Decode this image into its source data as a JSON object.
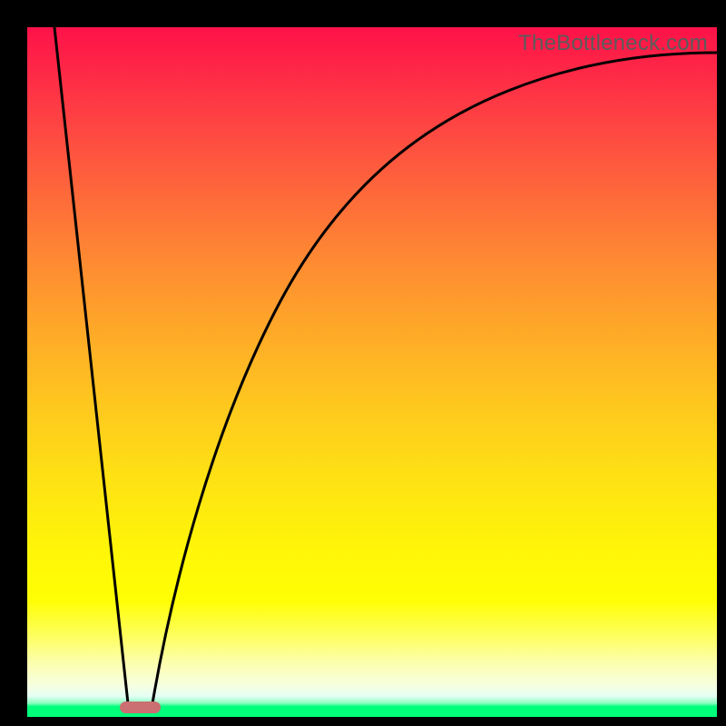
{
  "watermark": "TheBottleneck.com",
  "colors": {
    "frame": "#000000",
    "curve_stroke": "#000000",
    "marker_fill": "#cb6f72",
    "gradient_top": "#fe1248",
    "gradient_bottom": "#00ff7b"
  },
  "chart_data": {
    "type": "line",
    "title": "",
    "xlabel": "",
    "ylabel": "",
    "xlim": [
      0,
      100
    ],
    "ylim": [
      0,
      100
    ],
    "note": "No axis tick labels or numeric annotations are visible in the image; y-values below are read as percent of plot height from bottom, x as percent of plot width from left.",
    "series": [
      {
        "name": "left-descending-segment",
        "x": [
          4.0,
          8.0,
          12.0,
          14.6
        ],
        "y": [
          100.0,
          67.0,
          33.0,
          2.0
        ]
      },
      {
        "name": "right-ascending-curve",
        "x": [
          18.2,
          20.0,
          24.0,
          28.0,
          33.0,
          40.0,
          48.0,
          57.0,
          67.0,
          78.0,
          89.0,
          100.0
        ],
        "y": [
          2.0,
          11.0,
          30.0,
          45.0,
          58.0,
          70.0,
          79.0,
          85.5,
          90.0,
          93.0,
          95.0,
          96.2
        ]
      }
    ],
    "marker": {
      "shape": "rounded-bar",
      "x_center": 16.4,
      "y_center": 1.1,
      "width_pct": 5.9,
      "height_pct": 1.7
    }
  }
}
